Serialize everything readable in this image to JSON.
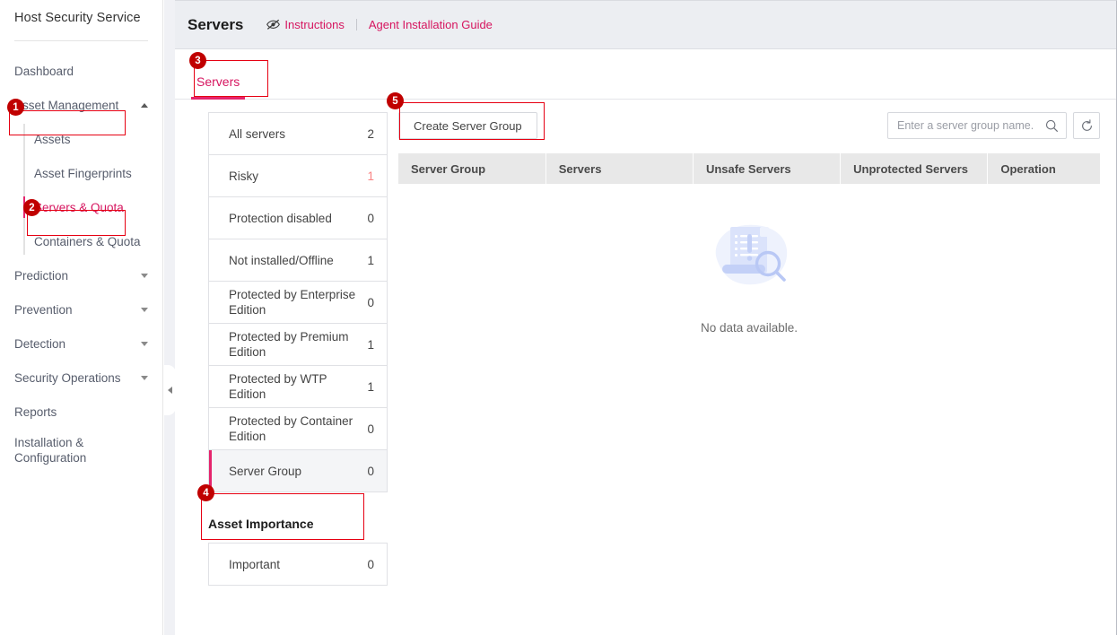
{
  "sidebar": {
    "brand": "Host Security Service",
    "items": [
      {
        "label": "Dashboard",
        "caret": null,
        "active": false
      },
      {
        "label": "Asset Management",
        "caret": "up",
        "active": false
      },
      {
        "label": "Prediction",
        "caret": "down",
        "active": false
      },
      {
        "label": "Prevention",
        "caret": "down",
        "active": false
      },
      {
        "label": "Detection",
        "caret": "down",
        "active": false
      },
      {
        "label": "Security Operations",
        "caret": "down",
        "active": false
      },
      {
        "label": "Reports",
        "caret": null,
        "active": false
      },
      {
        "label": "Installation & Configuration",
        "caret": null,
        "active": false
      }
    ],
    "subitems": [
      {
        "label": "Assets",
        "active": false
      },
      {
        "label": "Asset Fingerprints",
        "active": false
      },
      {
        "label": "Servers & Quota",
        "active": true
      },
      {
        "label": "Containers & Quota",
        "active": false
      }
    ],
    "collapse_icon": "chevron-left-icon"
  },
  "header": {
    "title": "Servers",
    "instructions_label": "Instructions",
    "instructions_icon": "eye-slash-icon",
    "agent_guide_label": "Agent Installation Guide"
  },
  "tabs": [
    {
      "label": "Servers",
      "active": true
    }
  ],
  "filters": {
    "items": [
      {
        "label": "All servers",
        "count": "2",
        "danger": false,
        "selected": false
      },
      {
        "label": "Risky",
        "count": "1",
        "danger": true,
        "selected": false
      },
      {
        "label": "Protection disabled",
        "count": "0",
        "danger": false,
        "selected": false
      },
      {
        "label": "Not installed/Offline",
        "count": "1",
        "danger": false,
        "selected": false
      },
      {
        "label": "Protected by Enterprise Edition",
        "count": "0",
        "danger": false,
        "selected": false
      },
      {
        "label": "Protected by Premium Edition",
        "count": "1",
        "danger": false,
        "selected": false
      },
      {
        "label": "Protected by WTP Edition",
        "count": "1",
        "danger": false,
        "selected": false
      },
      {
        "label": "Protected by Container Edition",
        "count": "0",
        "danger": false,
        "selected": false
      },
      {
        "label": "Server Group",
        "count": "0",
        "danger": false,
        "selected": true
      }
    ],
    "asset_importance_title": "Asset Importance",
    "importance_items": [
      {
        "label": "Important",
        "count": "0",
        "danger": false,
        "selected": false
      }
    ]
  },
  "toolbar": {
    "create_group_label": "Create Server Group",
    "search_placeholder": "Enter a server group name.",
    "search_value": "",
    "search_icon": "search-icon",
    "refresh_icon": "refresh-icon"
  },
  "table": {
    "columns": [
      "Server Group",
      "Servers",
      "Unsafe Servers",
      "Unprotected Servers",
      "Operation"
    ],
    "rows": [],
    "empty_text": "No data available.",
    "empty_icon": "no-data-illustration"
  },
  "callouts": [
    {
      "num": "1"
    },
    {
      "num": "2"
    },
    {
      "num": "3"
    },
    {
      "num": "4"
    },
    {
      "num": "5"
    }
  ],
  "colors": {
    "accent": "#d6155f",
    "accent_bar": "#e5246c",
    "callout": "#e60012",
    "badge": "#c00000",
    "danger_count": "#fa8383"
  }
}
